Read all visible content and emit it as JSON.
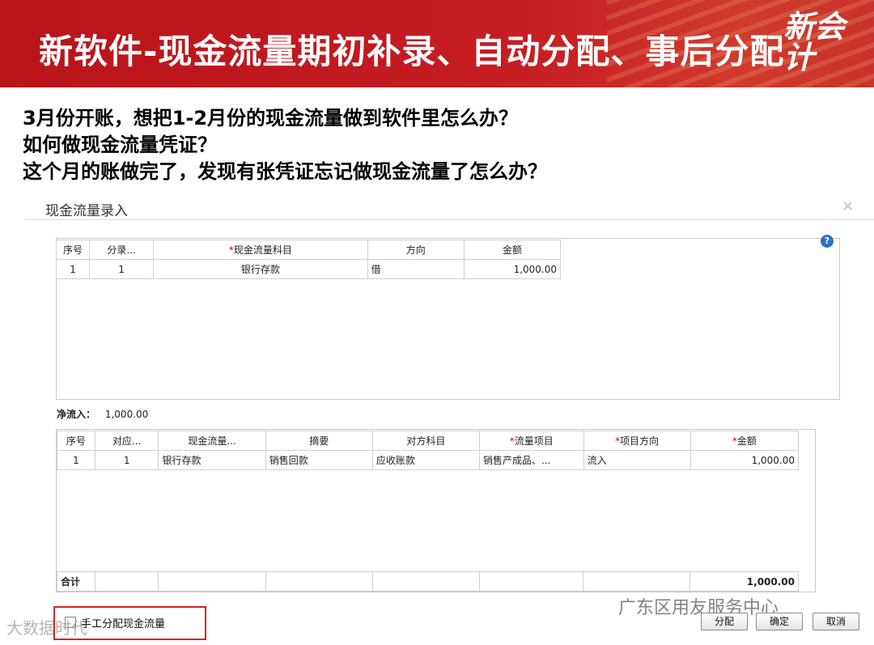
{
  "banner": {
    "title": "新软件-现金流量期初补录、自动分配、事后分配",
    "logo_text": "新会\n计"
  },
  "questions": [
    "3月份开账，想把1-2月份的现金流量做到软件里怎么办？",
    "如何做现金流量凭证？",
    "这个月的账做完了，发现有张凭证忘记做现金流量了怎么办？"
  ],
  "dialog": {
    "title": "现金流量录入",
    "close": "×",
    "help": "?"
  },
  "top_table": {
    "headers": [
      "序号",
      "分录...",
      "现金流量科目",
      "方向",
      "金额"
    ],
    "rows": [
      [
        "1",
        "1",
        "银行存款",
        "借",
        "1,000.00"
      ]
    ]
  },
  "net_inflow": {
    "label": "净流入：",
    "value": "1,000.00"
  },
  "bottom_table": {
    "headers": [
      "序号",
      "对应...",
      "现金流量...",
      "摘要",
      "对方科目",
      "流量项目",
      "项目方向",
      "金额"
    ],
    "rows": [
      [
        "1",
        "1",
        "银行存款",
        "销售回款",
        "应收账款",
        "销售产成品、...",
        "流入",
        "1,000.00"
      ]
    ],
    "total_label": "合计",
    "total_value": "1,000.00"
  },
  "manual_checkbox": {
    "label": "手工分配现金流量",
    "checked": false
  },
  "buttons": {
    "allocate": "分配",
    "ok": "确定",
    "cancel": "取消"
  },
  "watermarks": {
    "left": "大数据时代",
    "right": "广东区用友服务中心"
  }
}
